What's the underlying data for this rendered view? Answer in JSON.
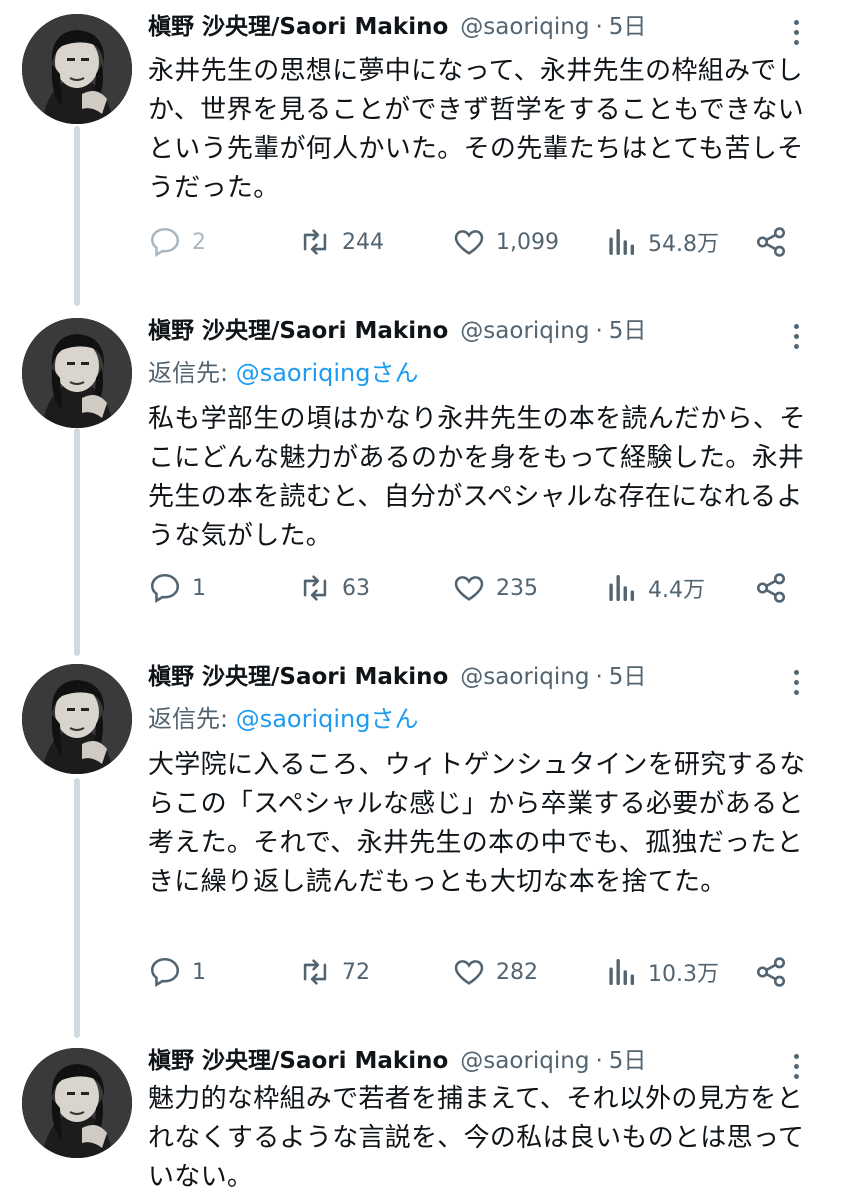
{
  "tweets": [
    {
      "name": "槇野 沙央理/Saori Makino",
      "handle": "@saoriqing",
      "dot": "·",
      "time": "5日",
      "reply_prefix": "",
      "reply_mention": "",
      "reply_suffix": "",
      "text": "永井先生の思想に夢中になって、永井先生の枠組みでしか、世界を見ることができず哲学をすることもできないという先輩が何人かいた。その先輩たちはとても苦しそうだった。",
      "replies": "2",
      "retweets": "244",
      "likes": "1,099",
      "views": "54.8万"
    },
    {
      "name": "槇野 沙央理/Saori Makino",
      "handle": "@saoriqing",
      "dot": "·",
      "time": "5日",
      "reply_prefix": "返信先: ",
      "reply_mention": "@saoriqing",
      "reply_suffix": "さん",
      "text": "私も学部生の頃はかなり永井先生の本を読んだから、そこにどんな魅力があるのかを身をもって経験した。永井先生の本を読むと、自分がスペシャルな存在になれるような気がした。",
      "replies": "1",
      "retweets": "63",
      "likes": "235",
      "views": "4.4万"
    },
    {
      "name": "槇野 沙央理/Saori Makino",
      "handle": "@saoriqing",
      "dot": "·",
      "time": "5日",
      "reply_prefix": "返信先: ",
      "reply_mention": "@saoriqing",
      "reply_suffix": "さん",
      "text": "大学院に入るころ、ウィトゲンシュタインを研究するならこの「スペシャルな感じ」から卒業する必要があると考えた。それで、永井先生の本の中でも、孤独だったときに繰り返し読んだもっとも大切な本を捨てた。",
      "replies": "1",
      "retweets": "72",
      "likes": "282",
      "views": "10.3万"
    },
    {
      "name": "槇野 沙央理/Saori Makino",
      "handle": "@saoriqing",
      "dot": "·",
      "time": "5日",
      "reply_prefix": "",
      "reply_mention": "",
      "reply_suffix": "",
      "text": "魅力的な枠組みで若者を捕まえて、それ以外の見方をとれなくするような言説を、今の私は良いものとは思っていない。",
      "replies": "",
      "retweets": "",
      "likes": "",
      "views": ""
    }
  ],
  "icons": {
    "reply": "speech-bubble-icon",
    "retweet": "retweet-arrows-icon",
    "like": "heart-icon",
    "views": "bar-chart-icon",
    "share": "share-nodes-icon",
    "more": "vertical-dots-icon"
  },
  "colors": {
    "text": "#0f1419",
    "muted": "#536471",
    "link": "#1d9bf0",
    "thread_line": "#cfd9de"
  }
}
